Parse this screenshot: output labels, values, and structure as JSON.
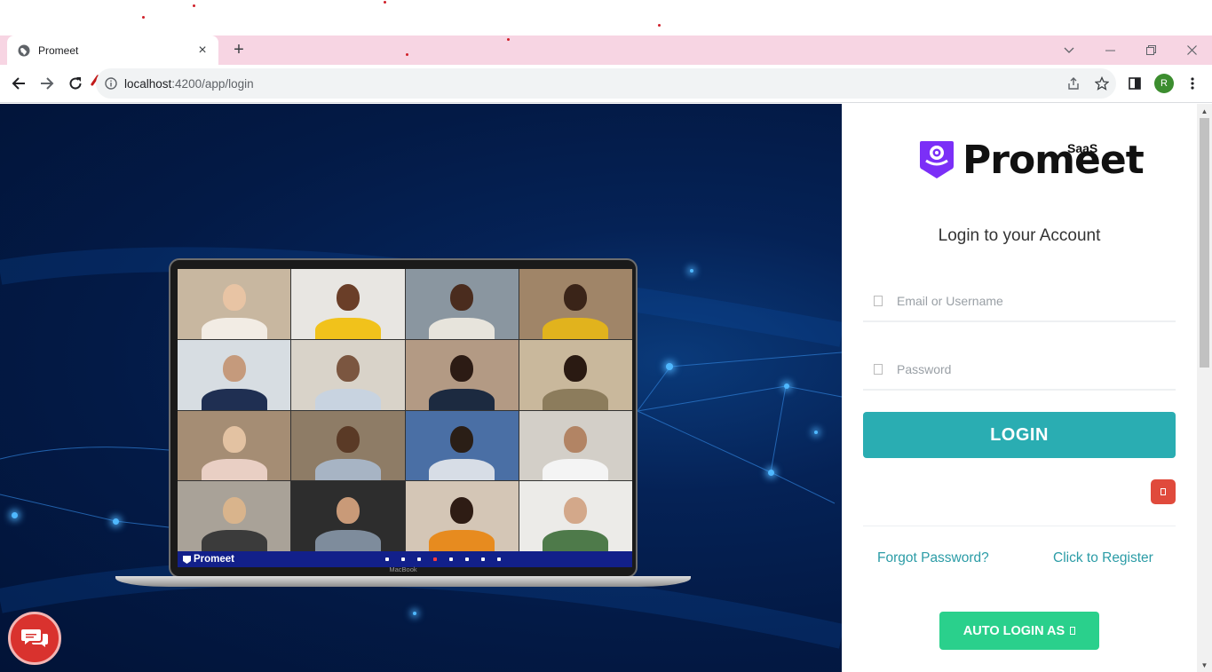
{
  "browser": {
    "tab_title": "Promeet",
    "tab_close": "×",
    "new_tab": "+",
    "url_host": "localhost",
    "url_rest": ":4200/app/login",
    "profile_initial": "R",
    "icons": [
      "back-arrow-icon",
      "forward-arrow-icon",
      "reload-icon",
      "info-icon",
      "share-icon",
      "star-icon",
      "sidepanel-icon",
      "kebab-menu-icon"
    ]
  },
  "brand": {
    "name": "Promeet",
    "tier": "SaaS",
    "accent": "#7b2ff7"
  },
  "login": {
    "heading": "Login to your Account",
    "email_placeholder": "Email or Username",
    "password_placeholder": "Password",
    "submit_label": "LOGIN",
    "forgot_label": "Forgot Password?",
    "register_label": "Click to Register",
    "auto_login_label": "AUTO LOGIN AS",
    "colors": {
      "login_button": "#2aadb2",
      "auto_login_button": "#2ad08c",
      "link": "#2b9ca6"
    }
  },
  "hero": {
    "laptop_label": "MacBook",
    "meeting_brand": "Promeet"
  }
}
